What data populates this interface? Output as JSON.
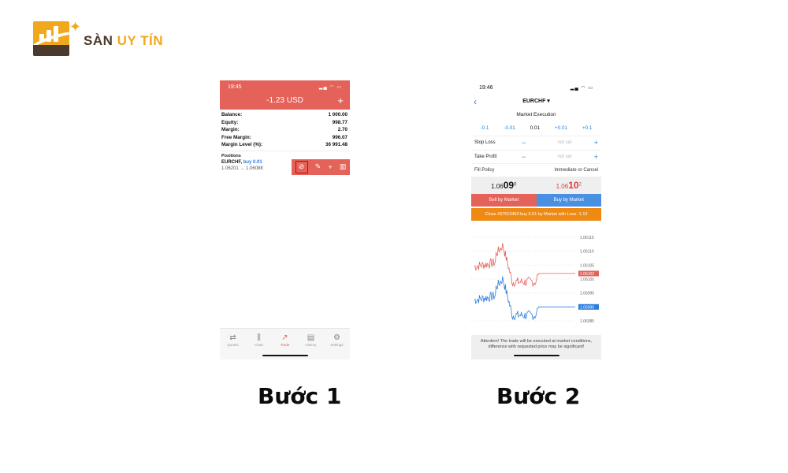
{
  "logo": {
    "text_part1": "SÀN",
    "text_part2": "UY TÍN",
    "brand_color": "#f2a81d",
    "dark_color": "#4a3a2e"
  },
  "step1": {
    "label": "Bước 1",
    "status_time": "19:45",
    "title": "-1.23 USD",
    "header_color": "#e4625a",
    "account": [
      {
        "label": "Balance:",
        "value": "1 000.00"
      },
      {
        "label": "Equity:",
        "value": "998.77"
      },
      {
        "label": "Margin:",
        "value": "2.70"
      },
      {
        "label": "Free Margin:",
        "value": "996.07"
      },
      {
        "label": "Margin Level (%):",
        "value": "36 991.48"
      }
    ],
    "positions_header": "Positions",
    "position": {
      "symbol": "EURCHF,",
      "side": "buy 0.01",
      "price_from": "1.06201",
      "arrow": "→",
      "price_to": "1.06088"
    },
    "tabs": [
      {
        "label": "Quotes",
        "icon": "quotes-icon",
        "glyph": "⇄"
      },
      {
        "label": "Chart",
        "icon": "chart-icon",
        "glyph": "⫼"
      },
      {
        "label": "Trade",
        "icon": "trade-icon",
        "glyph": "↗",
        "active": true
      },
      {
        "label": "History",
        "icon": "history-icon",
        "glyph": "▤"
      },
      {
        "label": "Settings",
        "icon": "settings-icon",
        "glyph": "⚙"
      }
    ]
  },
  "step2": {
    "label": "Bước 2",
    "status_time": "19:46",
    "symbol": "EURCHF ▾",
    "execution": "Market Execution",
    "volume": {
      "minus_big": "-0.1",
      "minus_small": "-0.01",
      "value": "0.01",
      "plus_small": "+0.01",
      "plus_big": "+0.1"
    },
    "stop_loss": {
      "label": "Stop Loss",
      "value": "not set"
    },
    "take_profit": {
      "label": "Take Profit",
      "value": "not set"
    },
    "fill_policy": {
      "label": "Fill Policy",
      "value": "Immediate or Cancel"
    },
    "bid": {
      "prefix": "1.06",
      "big": "09",
      "sup": "0"
    },
    "ask": {
      "prefix": "1.06",
      "big": "10",
      "sup": "2"
    },
    "sell_label": "Sell by Market",
    "buy_label": "Buy by Market",
    "close_label": "Close #37513453 buy 0.01 by Market with Loss -1.13",
    "attention": "Attention! The trade will be executed at market conditions, difference with requested price may be significant!",
    "chart_axis": [
      "1.06115",
      "1.06110",
      "1.06105",
      "1.06100",
      "1.06095",
      "1.06085"
    ],
    "ask_tag": "1.06102",
    "bid_tag": "1.06090",
    "colors": {
      "ask_line": "#e4625a",
      "bid_line": "#2b7de0",
      "sell": "#e4625a",
      "buy": "#4a90e2",
      "close": "#ee8a14"
    }
  }
}
